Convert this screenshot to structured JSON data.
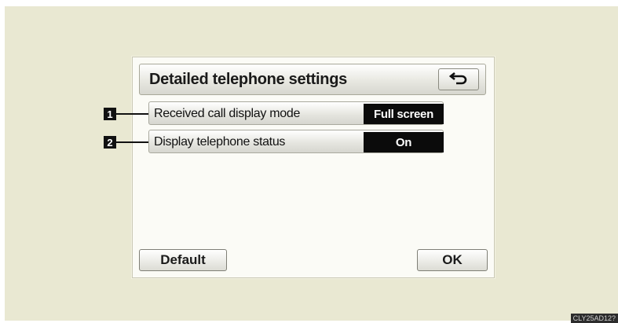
{
  "window": {
    "title": "Detailed telephone settings"
  },
  "settings": [
    {
      "callout": "1",
      "label": "Received call display mode",
      "value": "Full screen"
    },
    {
      "callout": "2",
      "label": "Display telephone status",
      "value": "On"
    }
  ],
  "buttons": {
    "default_label": "Default",
    "ok_label": "OK"
  },
  "icons": {
    "back": "back-arrow-icon"
  },
  "image_code": "CLY25AD12?",
  "colors": {
    "bezel": "#e9e8d2",
    "screen": "#fbfbf6",
    "value_bg": "#0b0b0b"
  }
}
